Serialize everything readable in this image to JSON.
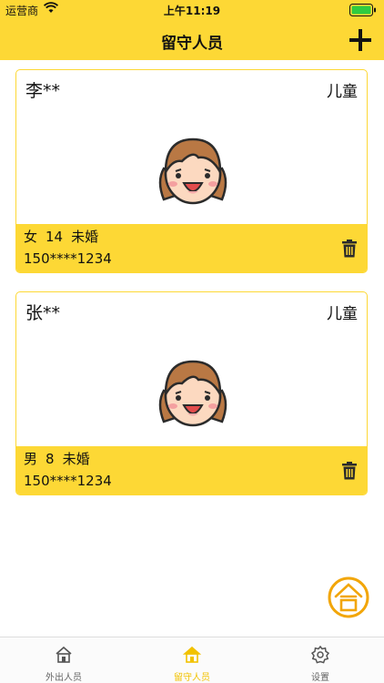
{
  "status_bar": {
    "carrier": "运营商",
    "time": "上午11:19"
  },
  "nav": {
    "title": "留守人员",
    "add_icon": "plus-icon"
  },
  "people": [
    {
      "name": "李**",
      "type": "儿童",
      "gender": "女",
      "age": "14",
      "marital": "未婚",
      "phone": "150****1234"
    },
    {
      "name": "张**",
      "type": "儿童",
      "gender": "男",
      "age": "8",
      "marital": "未婚",
      "phone": "150****1234"
    }
  ],
  "fab": {
    "icon": "he-character-icon"
  },
  "tabbar": {
    "items": [
      {
        "label": "外出人员",
        "icon": "house-icon"
      },
      {
        "label": "留守人员",
        "icon": "house-icon"
      },
      {
        "label": "设置",
        "icon": "gear-icon"
      }
    ],
    "active_index": 1
  },
  "colors": {
    "accent": "#FDD835",
    "fab": "#F2A60A",
    "active_tab": "#F2C200"
  }
}
